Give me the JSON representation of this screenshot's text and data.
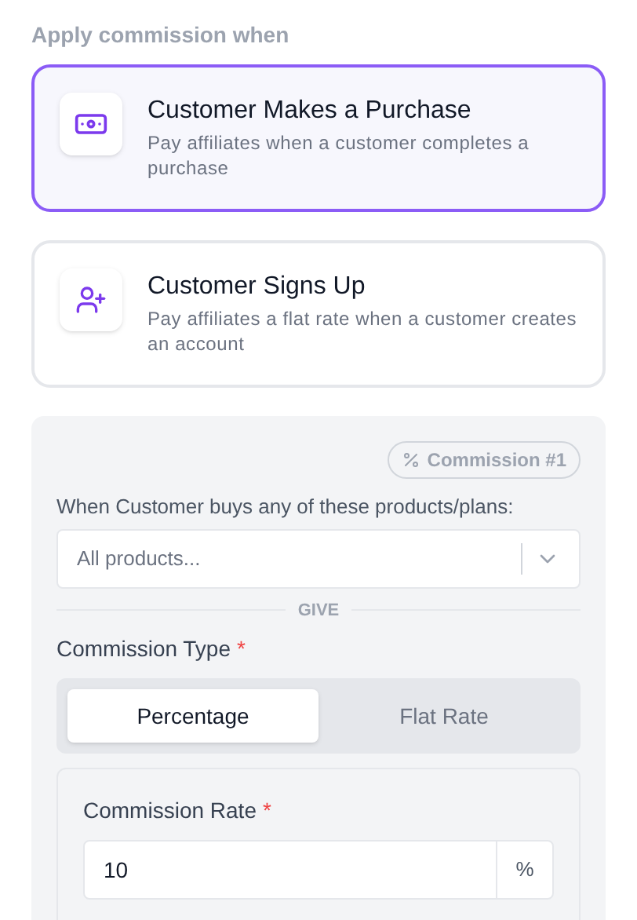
{
  "heading": "Apply commission when",
  "options": [
    {
      "kind": "purchase",
      "title": "Customer Makes a Purchase",
      "description": "Pay affiliates when a customer completes a purchase",
      "selected": true
    },
    {
      "kind": "signup",
      "title": "Customer Signs Up",
      "description": "Pay affiliates a flat rate when a customer creates an account",
      "selected": false
    }
  ],
  "commission": {
    "badge": "Commission #1",
    "products_label": "When Customer buys any of these products/plans:",
    "products_placeholder": "All products...",
    "divider": "GIVE",
    "type_label": "Commission Type",
    "type_required": "*",
    "types": [
      {
        "label": "Percentage",
        "selected": true
      },
      {
        "label": "Flat Rate",
        "selected": false
      }
    ],
    "rate_label": "Commission Rate",
    "rate_required": "*",
    "rate_value": "10",
    "rate_unit": "%"
  }
}
